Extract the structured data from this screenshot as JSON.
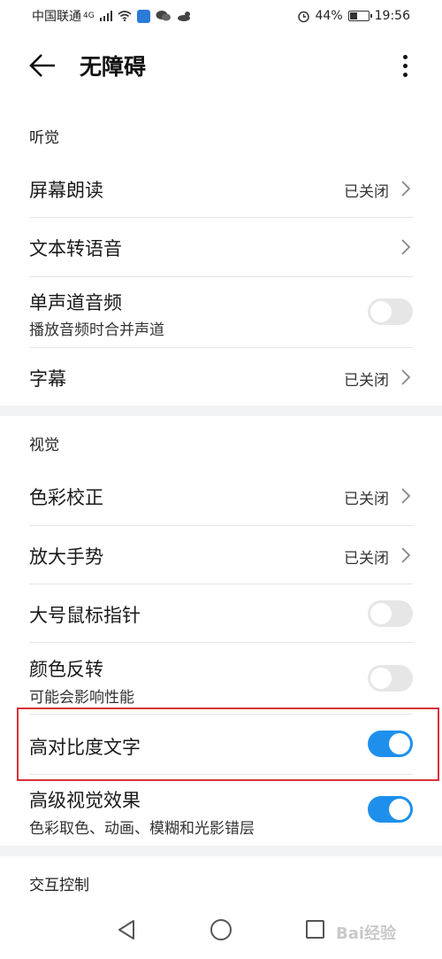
{
  "status_bar": {
    "carrier": "中国联通",
    "network": "4G",
    "battery_percent": "44%",
    "battery_level": 0.44,
    "time": "19:56",
    "icons": [
      "signal-icon",
      "wifi-icon",
      "shield-app-icon",
      "wechat-icon",
      "weather-icon",
      "alarm-icon",
      "battery-icon"
    ]
  },
  "header": {
    "title": "无障碍",
    "back_icon": "arrow-left-icon",
    "more_icon": "more-vertical-icon"
  },
  "sections": {
    "hearing": {
      "title": "听觉",
      "items": [
        {
          "label": "屏幕朗读",
          "value": "已关闭"
        },
        {
          "label": "文本转语音",
          "value": ""
        },
        {
          "label": "单声道音频",
          "sub": "播放音频时合并声道",
          "toggle": false
        },
        {
          "label": "字幕",
          "value": "已关闭"
        }
      ]
    },
    "vision": {
      "title": "视觉",
      "items": [
        {
          "label": "色彩校正",
          "value": "已关闭"
        },
        {
          "label": "放大手势",
          "value": "已关闭"
        },
        {
          "label": "大号鼠标指针",
          "toggle": false
        },
        {
          "label": "颜色反转",
          "sub": "可能会影响性能",
          "toggle": false
        },
        {
          "label": "高对比度文字",
          "toggle": true
        },
        {
          "label": "高级视觉效果",
          "sub": "色彩取色、动画、模糊和光影错层",
          "toggle": true
        }
      ]
    },
    "interaction": {
      "title": "交互控制"
    }
  },
  "nav_bar": {
    "icons": [
      "nav-back-icon",
      "nav-home-icon",
      "nav-recent-icon"
    ],
    "watermark": "Bai经验"
  },
  "colors": {
    "accent": "#1e90ec",
    "highlight": "#d7323a"
  }
}
